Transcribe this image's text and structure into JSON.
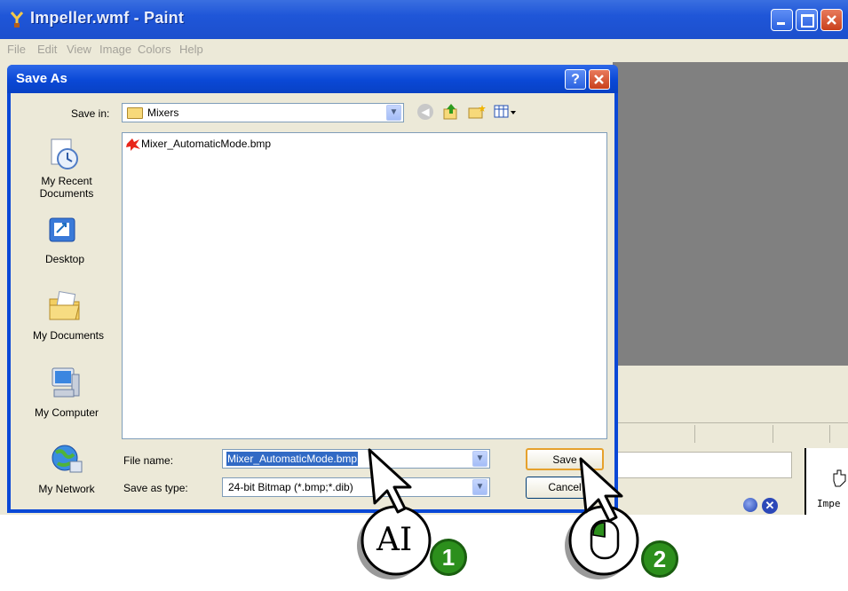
{
  "paint_window": {
    "title": "Impeller.wmf - Paint",
    "menu": [
      "File",
      "Edit",
      "View",
      "Image",
      "Colors",
      "Help"
    ],
    "side_panel_text": "Impe"
  },
  "dialog": {
    "title": "Save As",
    "save_in_label": "Save in:",
    "save_in_value": "Mixers",
    "places": [
      "My Recent Documents",
      "Desktop",
      "My Documents",
      "My Computer",
      "My Network"
    ],
    "files": [
      "Mixer_AutomaticMode.bmp"
    ],
    "file_name_label": "File name:",
    "file_name_value": "Mixer_AutomaticMode.bmp",
    "save_as_type_label": "Save as type:",
    "save_as_type_value": "24-bit Bitmap (*.bmp;*.dib)",
    "save_button": "Save",
    "cancel_button": "Cancel"
  },
  "callouts": [
    {
      "number": "1",
      "action": "type"
    },
    {
      "number": "2",
      "action": "click"
    }
  ],
  "colors": {
    "title_blue": "#0a48d6",
    "dialog_bg": "#ece9d8",
    "callout_green": "#2c8f1c"
  }
}
